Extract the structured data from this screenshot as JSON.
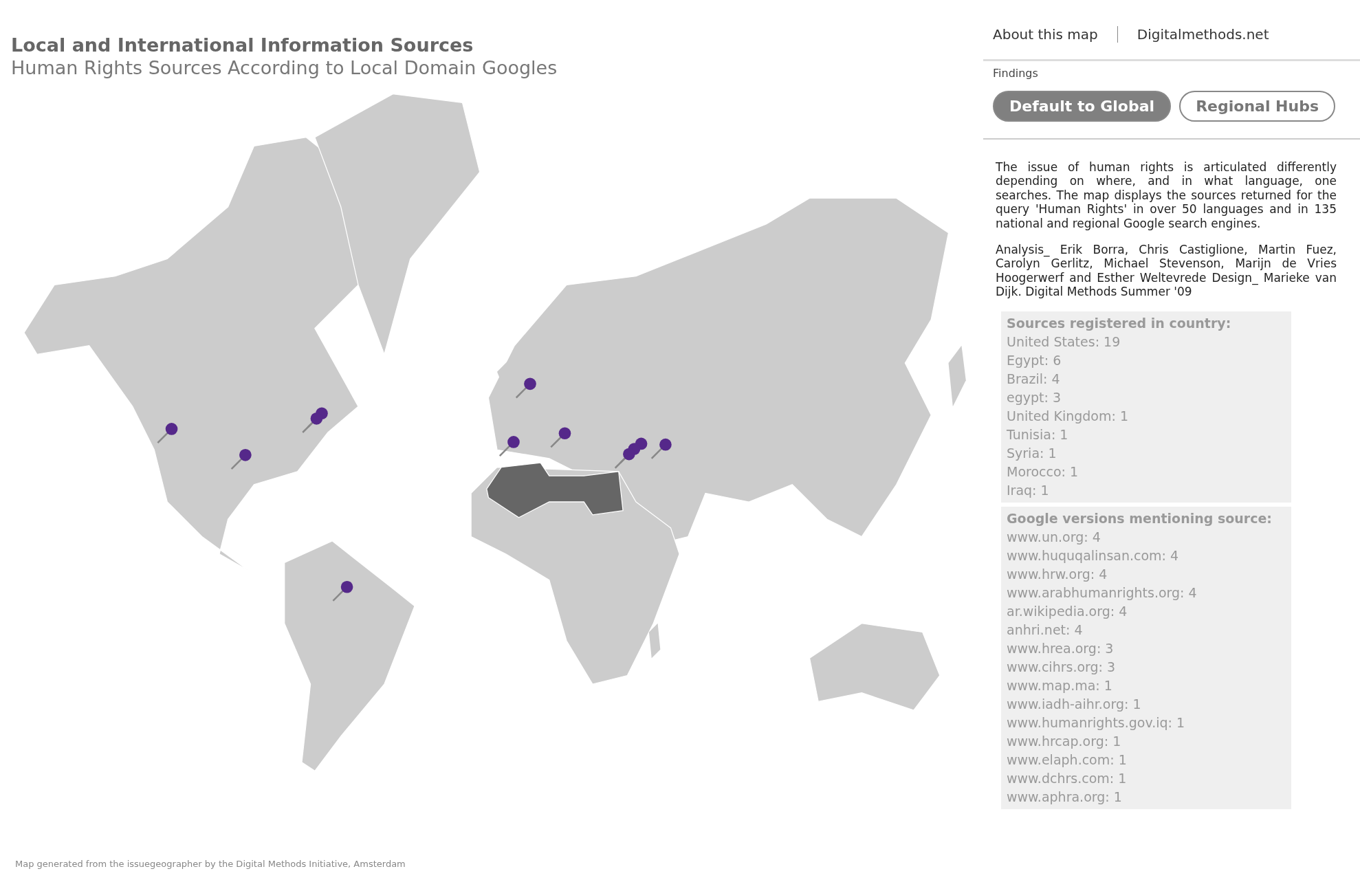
{
  "title": "Local and International Information Sources",
  "subtitle": "Human Rights Sources According to Local Domain Googles",
  "footer_note": "Map generated from the issuegeographer by the Digital Methods Initiative, Amsterdam",
  "header_links": [
    "About this map",
    "Digitalmethods.net"
  ],
  "findings": {
    "label": "Findings",
    "tabs": [
      {
        "label": "Default to Global",
        "selected": true
      },
      {
        "label": "Regional Hubs",
        "selected": false
      }
    ]
  },
  "description": [
    "The issue of human rights is articulated differently depending on where, and in what language, one searches. The map displays the sources returned for the query 'Human Rights' in over 50 languages and in 135 national and regional Google search engines.",
    "Analysis_ Erik Borra, Chris Castiglione, Martin Fuez, Carolyn Gerlitz, Michael Stevenson, Marijn de Vries Hoogerwerf and Esther Weltevrede Design_ Marieke van Dijk. Digital Methods Summer '09"
  ],
  "sources_by_country": {
    "heading": "Sources registered in country:",
    "items": [
      "United States: 19",
      "Egypt: 6",
      "Brazil: 4",
      "egypt: 3",
      "United Kingdom: 1",
      "Tunisia: 1",
      "Syria: 1",
      "Morocco: 1",
      "Iraq: 1"
    ]
  },
  "google_versions": {
    "heading": "Google versions mentioning source:",
    "items": [
      "www.un.org: 4",
      "www.huquqalinsan.com: 4",
      "www.hrw.org: 4",
      "www.arabhumanrights.org: 4",
      "ar.wikipedia.org: 4",
      "anhri.net: 4",
      "www.hrea.org: 3",
      "www.cihrs.org: 3",
      "www.map.ma: 1",
      "www.iadh-aihr.org: 1",
      "www.humanrights.gov.iq: 1",
      "www.hrcap.org: 1",
      "www.elaph.com: 1",
      "www.dchrs.com: 1",
      "www.aphra.org: 1"
    ]
  }
}
